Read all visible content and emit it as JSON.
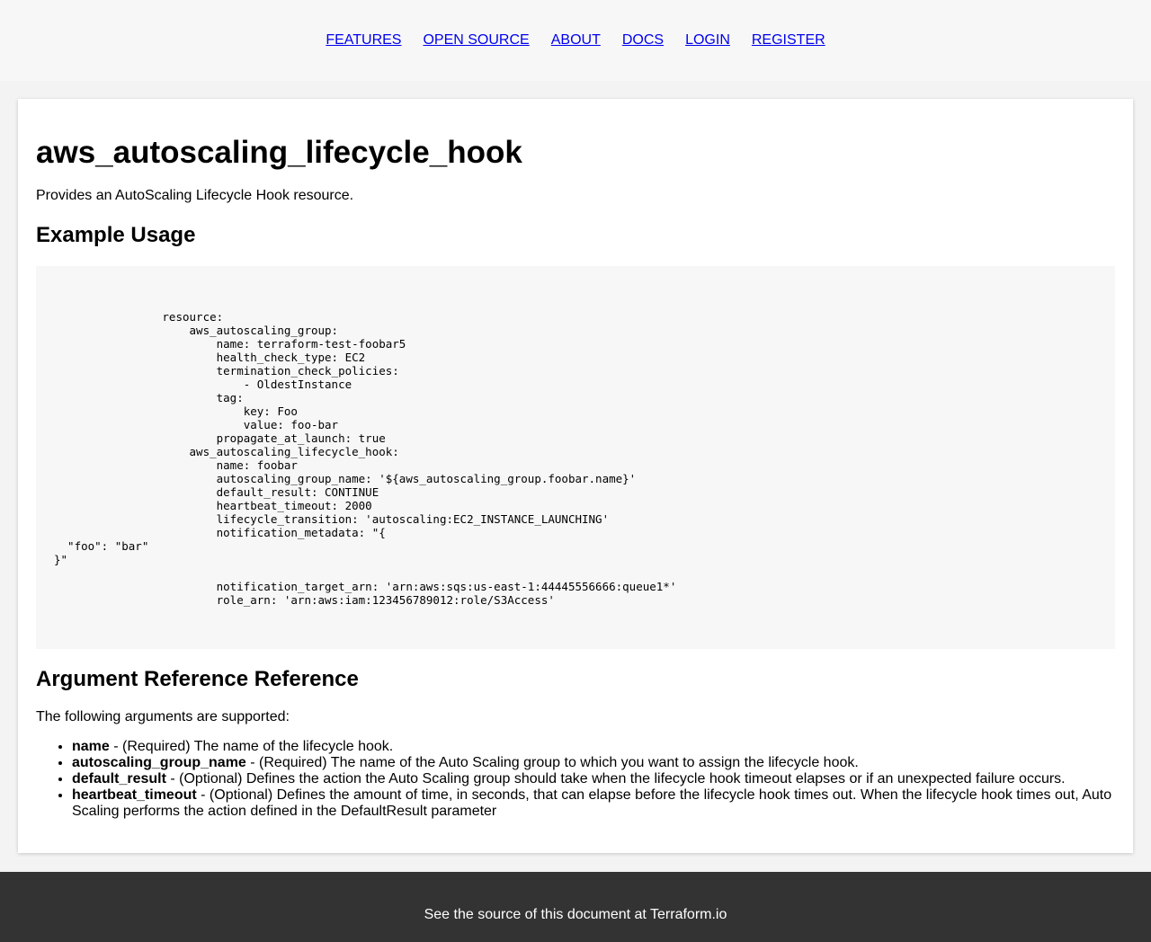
{
  "nav": {
    "links": [
      "FEATURES",
      "OPEN SOURCE",
      "ABOUT",
      "DOCS",
      "LOGIN",
      "REGISTER"
    ]
  },
  "doc": {
    "title": "aws_autoscaling_lifecycle_hook",
    "intro": "Provides an AutoScaling Lifecycle Hook resource.",
    "example_heading": "Example Usage",
    "code": "                resource:\n                    aws_autoscaling_group:\n                        name: terraform-test-foobar5\n                        health_check_type: EC2\n                        termination_check_policies:\n                            - OldestInstance\n                        tag:\n                            key: Foo\n                            value: foo-bar\n                        propagate_at_launch: true\n                    aws_autoscaling_lifecycle_hook:\n                        name: foobar\n                        autoscaling_group_name: '${aws_autoscaling_group.foobar.name}'\n                        default_result: CONTINUE\n                        heartbeat_timeout: 2000\n                        lifecycle_transition: 'autoscaling:EC2_INSTANCE_LAUNCHING'\n                        notification_metadata: \"{\n  \"foo\": \"bar\"\n}\"\n\n                        notification_target_arn: 'arn:aws:sqs:us-east-1:44445556666:queue1*'\n                        role_arn: 'arn:aws:iam:123456789012:role/S3Access'",
    "args_heading": "Argument Reference Reference",
    "args_intro": "The following arguments are supported:",
    "args": [
      {
        "name": "name",
        "desc": " - (Required) The name of the lifecycle hook."
      },
      {
        "name": "autoscaling_group_name",
        "desc": " - (Required) The name of the Auto Scaling group to which you want to assign the lifecycle hook."
      },
      {
        "name": "default_result",
        "desc": " - (Optional) Defines the action the Auto Scaling group should take when the lifecycle hook timeout elapses or if an unexpected failure occurs."
      },
      {
        "name": "heartbeat_timeout",
        "desc": " - (Optional) Defines the amount of time, in seconds, that can elapse before the lifecycle hook times out. When the lifecycle hook times out, Auto Scaling performs the action defined in the DefaultResult parameter"
      }
    ]
  },
  "footer": {
    "text": "See the source of this document at Terraform.io"
  }
}
